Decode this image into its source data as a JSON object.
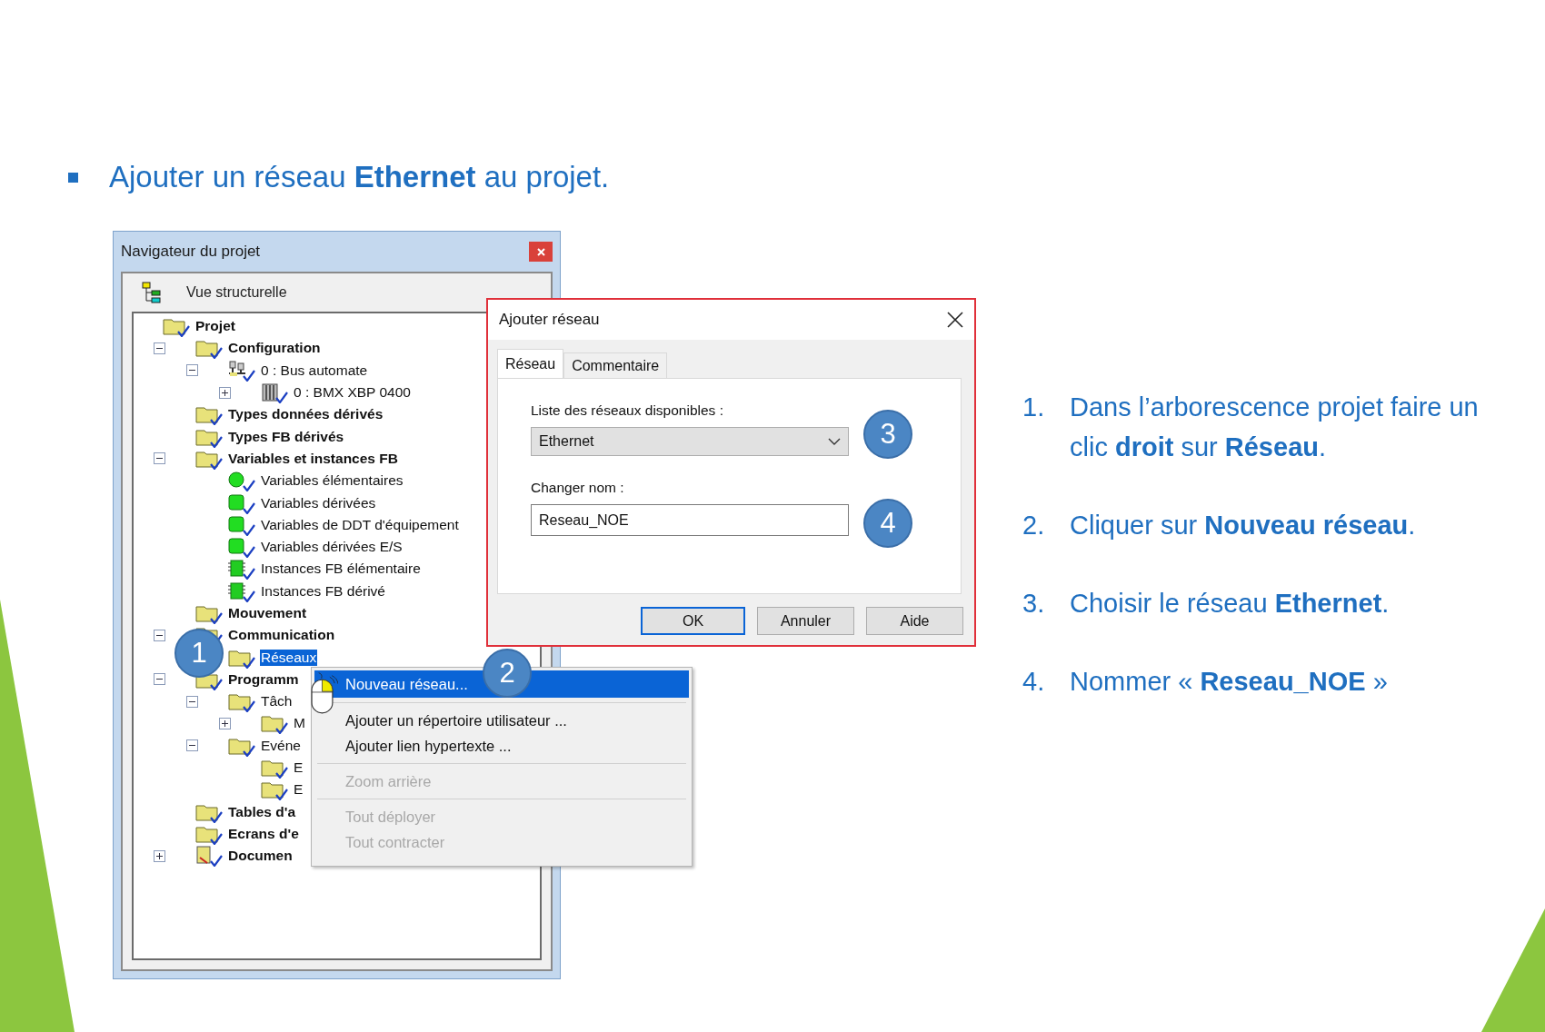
{
  "title": "Ajouter un réseau **Ethernet** au projet.",
  "navigator": {
    "title": "Navigateur du projet",
    "view": "Vue structurelle",
    "tree": [
      {
        "label": "Projet",
        "kind": "folder",
        "selected": false,
        "children": [
          {
            "label": "Configuration",
            "kind": "folder",
            "selected": false,
            "expanded": true,
            "children": [
              {
                "label": "0 : Bus automate",
                "kind": "bus",
                "selected": false,
                "expanded": true,
                "children": [
                  {
                    "label": "0 : BMX XBP 0400",
                    "kind": "rack",
                    "selected": false,
                    "expanded": false
                  }
                ]
              }
            ]
          },
          {
            "label": "Types données dérivés",
            "kind": "folder",
            "selected": false
          },
          {
            "label": "Types FB dérivés",
            "kind": "folder",
            "selected": false
          },
          {
            "label": "Variables et instances FB",
            "kind": "folder",
            "selected": false,
            "expanded": true,
            "children": [
              {
                "label": "Variables élémentaires",
                "kind": "dot",
                "selected": false
              },
              {
                "label": "Variables dérivées",
                "kind": "block",
                "selected": false
              },
              {
                "label": "Variables de DDT d'équipement",
                "kind": "block",
                "selected": false
              },
              {
                "label": "Variables dérivées E/S",
                "kind": "block",
                "selected": false
              },
              {
                "label": "Instances FB élémentaire",
                "kind": "module",
                "selected": false
              },
              {
                "label": "Instances FB dérivé",
                "kind": "module",
                "selected": false
              }
            ]
          },
          {
            "label": "Mouvement",
            "kind": "folder",
            "selected": false
          },
          {
            "label": "Communication",
            "kind": "folder",
            "selected": false,
            "expanded": true,
            "children": [
              {
                "label": "Réseaux",
                "kind": "folder",
                "selected": true
              }
            ]
          },
          {
            "label": "Programm",
            "kind": "folder",
            "selected": false,
            "expanded": true,
            "children": [
              {
                "label": "Tâch",
                "kind": "folder",
                "selected": false,
                "expanded": true,
                "children": [
                  {
                    "label": "M",
                    "kind": "folder",
                    "selected": false,
                    "expanded": false
                  }
                ]
              },
              {
                "label": "Evéne",
                "kind": "folder",
                "selected": false,
                "expanded": true,
                "children": [
                  {
                    "label": "E",
                    "kind": "folder",
                    "selected": false
                  },
                  {
                    "label": "E",
                    "kind": "folder",
                    "selected": false
                  }
                ]
              }
            ]
          },
          {
            "label": "Tables d'a",
            "kind": "folder",
            "selected": false
          },
          {
            "label": "Ecrans d'e",
            "kind": "folder",
            "selected": false
          },
          {
            "label": "Documen",
            "kind": "document",
            "selected": false,
            "expanded": false
          }
        ]
      }
    ]
  },
  "context_menu": [
    {
      "kind": "item",
      "label": "Nouveau réseau...",
      "selected": true,
      "disabled": false
    },
    {
      "kind": "separator"
    },
    {
      "kind": "item",
      "label": "Ajouter un répertoire utilisateur ...",
      "selected": false,
      "disabled": false
    },
    {
      "kind": "item",
      "label": "Ajouter lien hypertexte ...",
      "selected": false,
      "disabled": false
    },
    {
      "kind": "separator"
    },
    {
      "kind": "item",
      "label": "Zoom arrière",
      "selected": false,
      "disabled": true
    },
    {
      "kind": "separator"
    },
    {
      "kind": "item",
      "label": "Tout déployer",
      "selected": false,
      "disabled": true
    },
    {
      "kind": "item",
      "label": "Tout contracter",
      "selected": false,
      "disabled": true
    }
  ],
  "dialog": {
    "title": "Ajouter réseau",
    "tabs": [
      {
        "label": "Réseau",
        "selected": true
      },
      {
        "label": "Commentaire",
        "selected": false
      }
    ],
    "network_label": "Liste des réseaux disponibles :",
    "network_value": "Ethernet",
    "name_label": "Changer nom :",
    "name_value": "Reseau_NOE",
    "buttons": [
      {
        "label": "OK",
        "default": true
      },
      {
        "label": "Annuler",
        "default": false
      },
      {
        "label": "Aide",
        "default": false
      }
    ]
  },
  "callouts": [
    "1",
    "2",
    "3",
    "4"
  ],
  "steps": [
    {
      "number": "1.",
      "text": "Dans l’arborescence projet faire un clic **droit** sur **Réseau**."
    },
    {
      "number": "2.",
      "text": "Cliquer sur **Nouveau réseau**."
    },
    {
      "number": "3.",
      "text": "Choisir le réseau **Ethernet**."
    },
    {
      "number": "4.",
      "text": "Nommer « **Reseau_NOE** »"
    }
  ]
}
